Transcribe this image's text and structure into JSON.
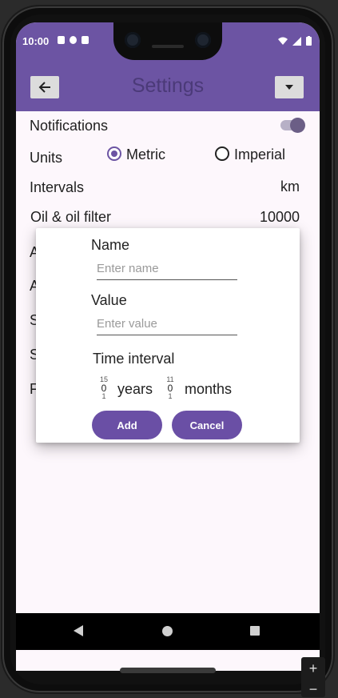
{
  "status_bar": {
    "time": "10:00",
    "icons": [
      "a-notification-icon",
      "p-notification-icon",
      "sd-card-icon",
      "wifi-icon",
      "signal-icon",
      "battery-icon"
    ]
  },
  "toolbar": {
    "title": "Settings",
    "back_icon": "back-arrow-icon",
    "menu_icon": "dropdown-arrow-icon"
  },
  "settings": {
    "notifications_label": "Notifications",
    "notifications_on": true,
    "units_label": "Units",
    "unit_options": [
      "Metric",
      "Imperial"
    ],
    "unit_selected": "Metric",
    "intervals_label": "Intervals",
    "intervals_unit": "km",
    "rows": [
      {
        "label": "Oil & oil filter",
        "value": "10000"
      },
      {
        "label": "A",
        "value": ""
      },
      {
        "label": "A",
        "value": ""
      },
      {
        "label": "S",
        "value": ""
      },
      {
        "label": "S",
        "value": ""
      },
      {
        "label": "F",
        "value": ""
      }
    ]
  },
  "dialog": {
    "name_label": "Name",
    "name_placeholder": "Enter name",
    "value_label": "Value",
    "value_placeholder": "Enter value",
    "time_interval_label": "Time interval",
    "years_picker": {
      "above": "15",
      "value": "0",
      "below": "1"
    },
    "years_label": "years",
    "months_picker": {
      "above": "11",
      "value": "0",
      "below": "1"
    },
    "months_label": "months",
    "add_label": "Add",
    "cancel_label": "Cancel"
  },
  "emulator_controls": {
    "zoom_in": "+",
    "zoom_out": "−"
  },
  "colors": {
    "primary": "#6c54a3",
    "title_text": "#4b3a78",
    "screen_bg": "#fdf7fc",
    "button": "#6a4fa5"
  }
}
